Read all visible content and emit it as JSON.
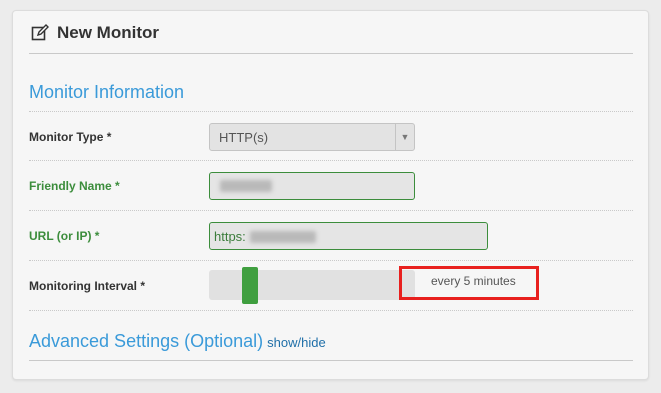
{
  "header": {
    "icon": "edit-icon",
    "title": "New Monitor"
  },
  "monitor_info": {
    "section_title": "Monitor Information"
  },
  "monitor_type": {
    "label": "Monitor Type *",
    "value": "HTTP(s)"
  },
  "friendly_name": {
    "label": "Friendly Name *",
    "value": ""
  },
  "url": {
    "label": "URL (or IP) *",
    "value": "https:"
  },
  "interval": {
    "label": "Monitoring Interval *",
    "text": "every 5 minutes",
    "minutes": 5
  },
  "advanced": {
    "title": "Advanced Settings (Optional)",
    "toggle": "show/hide"
  },
  "colors": {
    "accent": "#3a9ad9",
    "valid": "#3c8d3c",
    "slider": "#3f9f3f",
    "highlight": "#e8201e"
  }
}
